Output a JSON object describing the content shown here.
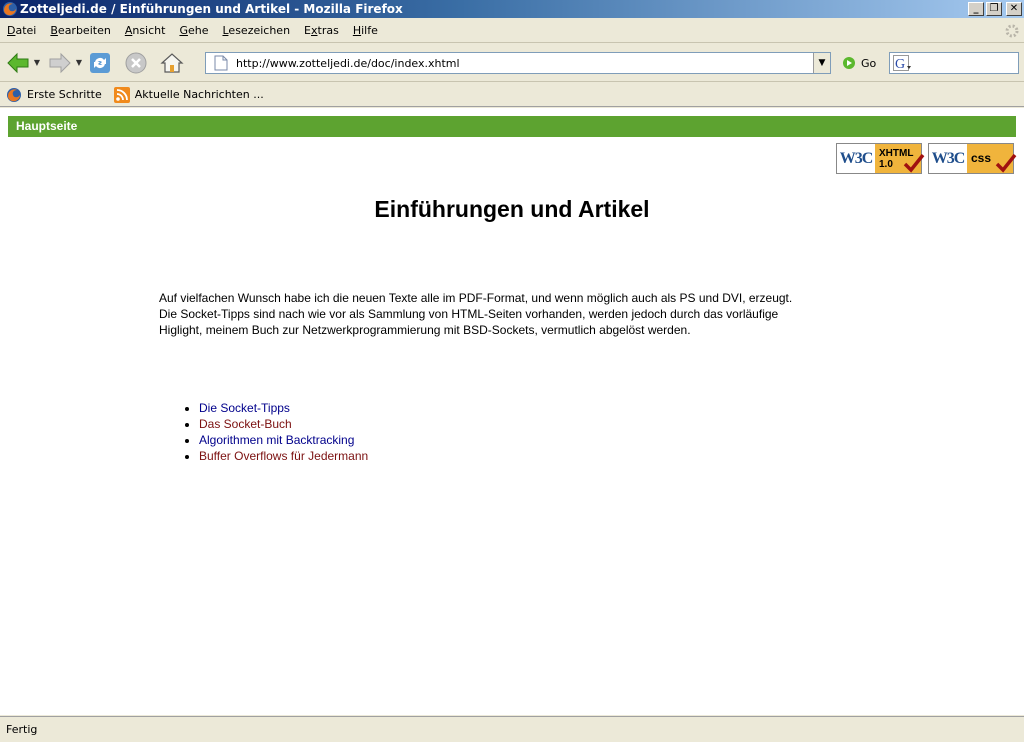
{
  "window": {
    "title": "Zotteljedi.de / Einführungen und Artikel - Mozilla Firefox"
  },
  "menu": {
    "items": [
      {
        "u": "D",
        "rest": "atei"
      },
      {
        "u": "B",
        "rest": "earbeiten"
      },
      {
        "u": "A",
        "rest": "nsicht"
      },
      {
        "u": "G",
        "rest": "ehe"
      },
      {
        "u": "L",
        "rest": "esezeichen"
      },
      {
        "pre": "E",
        "u": "x",
        "rest": "tras"
      },
      {
        "u": "H",
        "rest": "ilfe"
      }
    ]
  },
  "navbar": {
    "url": "http://www.zotteljedi.de/doc/index.xhtml",
    "go_label": "Go"
  },
  "bookmarks": {
    "items": [
      "Erste Schritte",
      "Aktuelle Nachrichten ..."
    ]
  },
  "page": {
    "nav_label": "Hauptseite",
    "badges": {
      "xhtml": {
        "w3c": "W3C",
        "line1": "XHTML",
        "line2": "1.0"
      },
      "css": {
        "w3c": "W3C",
        "line1": "css"
      }
    },
    "heading": "Einführungen und Artikel",
    "intro_lines": [
      "Auf vielfachen Wunsch habe ich die neuen Texte alle im PDF-Format, und wenn möglich auch als PS und DVI, erzeugt.",
      "Die Socket-Tipps sind nach wie vor als Sammlung von HTML-Seiten vorhanden, werden jedoch durch das vorläufige",
      "Higlight, meinem Buch zur Netzwerkprogrammierung mit BSD-Sockets, vermutlich abgelöst werden."
    ],
    "links": [
      "Die Socket-Tipps",
      "Das Socket-Buch",
      "Algorithmen mit Backtracking",
      "Buffer Overflows für Jedermann"
    ]
  },
  "status": {
    "text": "Fertig"
  },
  "colors": {
    "nav_bar": "#5da330",
    "link_unvisited": "#00008b",
    "link_visited": "#7b1010"
  }
}
